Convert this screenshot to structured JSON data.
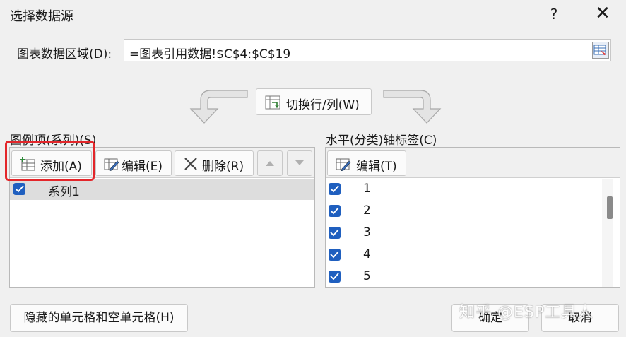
{
  "dialog": {
    "title": "选择数据源",
    "help_glyph": "?",
    "close_glyph": "✕"
  },
  "chart_range": {
    "label": "图表数据区域(D):",
    "value": "=图表引用数据!$C$4:$C$19"
  },
  "switch_button": {
    "label": "切换行/列(W)"
  },
  "legend_section": {
    "label": "图例项(系列)(S)",
    "add_label": "添加(A)",
    "edit_label": "编辑(E)",
    "delete_label": "删除(R)",
    "series": [
      {
        "name": "系列1",
        "checked": true
      }
    ]
  },
  "axis_section": {
    "label": "水平(分类)轴标签(C)",
    "edit_label": "编辑(T)",
    "items": [
      {
        "label": "1",
        "checked": true
      },
      {
        "label": "2",
        "checked": true
      },
      {
        "label": "3",
        "checked": true
      },
      {
        "label": "4",
        "checked": true
      },
      {
        "label": "5",
        "checked": true
      }
    ]
  },
  "footer": {
    "hidden_cells_label": "隐藏的单元格和空单元格(H)",
    "ok_label": "确定",
    "cancel_label": "取消"
  },
  "watermark": "知乎 @ESP工具人",
  "colors": {
    "checkbox": "#1f5fbf",
    "highlight": "#e3262a"
  }
}
